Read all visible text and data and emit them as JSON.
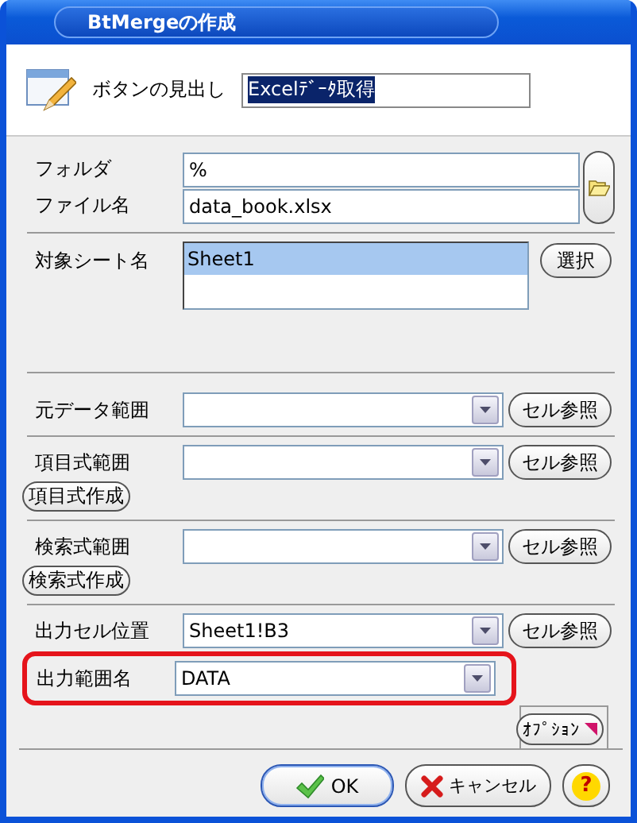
{
  "window": {
    "title": "BtMergeの作成"
  },
  "caption": {
    "label": "ボタンの見出し",
    "value": "Excelﾃﾞｰﾀ取得",
    "selected": true
  },
  "file": {
    "rows": [
      {
        "label": "フォルダ",
        "value": "%"
      },
      {
        "label": "ファイル名",
        "value": "data_book.xlsx"
      }
    ]
  },
  "sheet": {
    "label": "対象シート名",
    "items": [
      {
        "text": "Sheet1",
        "selected": true
      }
    ],
    "button": "選択"
  },
  "ranges": [
    {
      "label": "元データ範囲",
      "button": "セル参照"
    },
    {
      "label": "項目式範囲",
      "button": "セル参照",
      "create_button": "項目式作成"
    },
    {
      "label": "検索式範囲",
      "button": "セル参照",
      "create_button": "検索式作成"
    },
    {
      "label": "出力セル位置",
      "value": "Sheet1!B3",
      "button": "セル参照"
    }
  ],
  "output_name": {
    "label": "出力範囲名",
    "value": "DATA",
    "highlighted": true
  },
  "options_button": "ｵﾌﾟｼｮﾝ",
  "buttons": [
    {
      "kind": "ok",
      "label": "OK",
      "default": true
    },
    {
      "kind": "cancel",
      "label": "キャンセル",
      "default": false
    },
    {
      "kind": "help",
      "label": "?",
      "default": false
    }
  ]
}
